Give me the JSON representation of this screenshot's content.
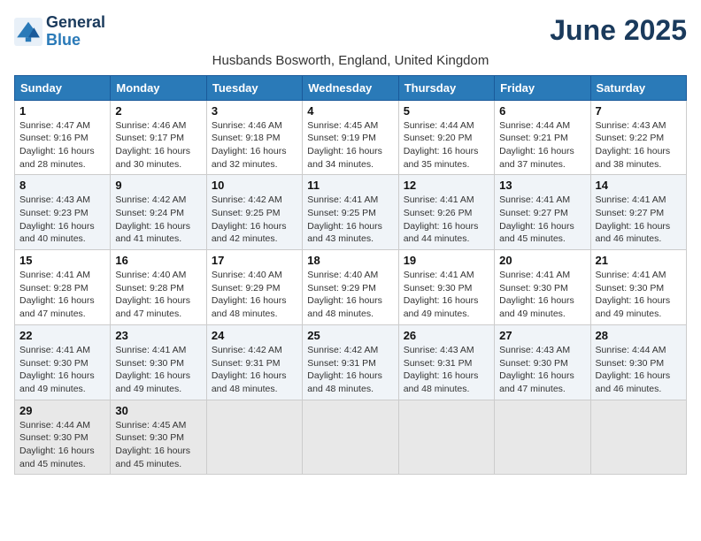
{
  "header": {
    "logo_line1": "General",
    "logo_line2": "Blue",
    "month_title": "June 2025",
    "subtitle": "Husbands Bosworth, England, United Kingdom"
  },
  "days_of_week": [
    "Sunday",
    "Monday",
    "Tuesday",
    "Wednesday",
    "Thursday",
    "Friday",
    "Saturday"
  ],
  "weeks": [
    [
      {
        "day": "1",
        "info": "Sunrise: 4:47 AM\nSunset: 9:16 PM\nDaylight: 16 hours\nand 28 minutes."
      },
      {
        "day": "2",
        "info": "Sunrise: 4:46 AM\nSunset: 9:17 PM\nDaylight: 16 hours\nand 30 minutes."
      },
      {
        "day": "3",
        "info": "Sunrise: 4:46 AM\nSunset: 9:18 PM\nDaylight: 16 hours\nand 32 minutes."
      },
      {
        "day": "4",
        "info": "Sunrise: 4:45 AM\nSunset: 9:19 PM\nDaylight: 16 hours\nand 34 minutes."
      },
      {
        "day": "5",
        "info": "Sunrise: 4:44 AM\nSunset: 9:20 PM\nDaylight: 16 hours\nand 35 minutes."
      },
      {
        "day": "6",
        "info": "Sunrise: 4:44 AM\nSunset: 9:21 PM\nDaylight: 16 hours\nand 37 minutes."
      },
      {
        "day": "7",
        "info": "Sunrise: 4:43 AM\nSunset: 9:22 PM\nDaylight: 16 hours\nand 38 minutes."
      }
    ],
    [
      {
        "day": "8",
        "info": "Sunrise: 4:43 AM\nSunset: 9:23 PM\nDaylight: 16 hours\nand 40 minutes."
      },
      {
        "day": "9",
        "info": "Sunrise: 4:42 AM\nSunset: 9:24 PM\nDaylight: 16 hours\nand 41 minutes."
      },
      {
        "day": "10",
        "info": "Sunrise: 4:42 AM\nSunset: 9:25 PM\nDaylight: 16 hours\nand 42 minutes."
      },
      {
        "day": "11",
        "info": "Sunrise: 4:41 AM\nSunset: 9:25 PM\nDaylight: 16 hours\nand 43 minutes."
      },
      {
        "day": "12",
        "info": "Sunrise: 4:41 AM\nSunset: 9:26 PM\nDaylight: 16 hours\nand 44 minutes."
      },
      {
        "day": "13",
        "info": "Sunrise: 4:41 AM\nSunset: 9:27 PM\nDaylight: 16 hours\nand 45 minutes."
      },
      {
        "day": "14",
        "info": "Sunrise: 4:41 AM\nSunset: 9:27 PM\nDaylight: 16 hours\nand 46 minutes."
      }
    ],
    [
      {
        "day": "15",
        "info": "Sunrise: 4:41 AM\nSunset: 9:28 PM\nDaylight: 16 hours\nand 47 minutes."
      },
      {
        "day": "16",
        "info": "Sunrise: 4:40 AM\nSunset: 9:28 PM\nDaylight: 16 hours\nand 47 minutes."
      },
      {
        "day": "17",
        "info": "Sunrise: 4:40 AM\nSunset: 9:29 PM\nDaylight: 16 hours\nand 48 minutes."
      },
      {
        "day": "18",
        "info": "Sunrise: 4:40 AM\nSunset: 9:29 PM\nDaylight: 16 hours\nand 48 minutes."
      },
      {
        "day": "19",
        "info": "Sunrise: 4:41 AM\nSunset: 9:30 PM\nDaylight: 16 hours\nand 49 minutes."
      },
      {
        "day": "20",
        "info": "Sunrise: 4:41 AM\nSunset: 9:30 PM\nDaylight: 16 hours\nand 49 minutes."
      },
      {
        "day": "21",
        "info": "Sunrise: 4:41 AM\nSunset: 9:30 PM\nDaylight: 16 hours\nand 49 minutes."
      }
    ],
    [
      {
        "day": "22",
        "info": "Sunrise: 4:41 AM\nSunset: 9:30 PM\nDaylight: 16 hours\nand 49 minutes."
      },
      {
        "day": "23",
        "info": "Sunrise: 4:41 AM\nSunset: 9:30 PM\nDaylight: 16 hours\nand 49 minutes."
      },
      {
        "day": "24",
        "info": "Sunrise: 4:42 AM\nSunset: 9:31 PM\nDaylight: 16 hours\nand 48 minutes."
      },
      {
        "day": "25",
        "info": "Sunrise: 4:42 AM\nSunset: 9:31 PM\nDaylight: 16 hours\nand 48 minutes."
      },
      {
        "day": "26",
        "info": "Sunrise: 4:43 AM\nSunset: 9:31 PM\nDaylight: 16 hours\nand 48 minutes."
      },
      {
        "day": "27",
        "info": "Sunrise: 4:43 AM\nSunset: 9:30 PM\nDaylight: 16 hours\nand 47 minutes."
      },
      {
        "day": "28",
        "info": "Sunrise: 4:44 AM\nSunset: 9:30 PM\nDaylight: 16 hours\nand 46 minutes."
      }
    ],
    [
      {
        "day": "29",
        "info": "Sunrise: 4:44 AM\nSunset: 9:30 PM\nDaylight: 16 hours\nand 45 minutes."
      },
      {
        "day": "30",
        "info": "Sunrise: 4:45 AM\nSunset: 9:30 PM\nDaylight: 16 hours\nand 45 minutes."
      },
      {
        "day": "",
        "info": ""
      },
      {
        "day": "",
        "info": ""
      },
      {
        "day": "",
        "info": ""
      },
      {
        "day": "",
        "info": ""
      },
      {
        "day": "",
        "info": ""
      }
    ]
  ]
}
